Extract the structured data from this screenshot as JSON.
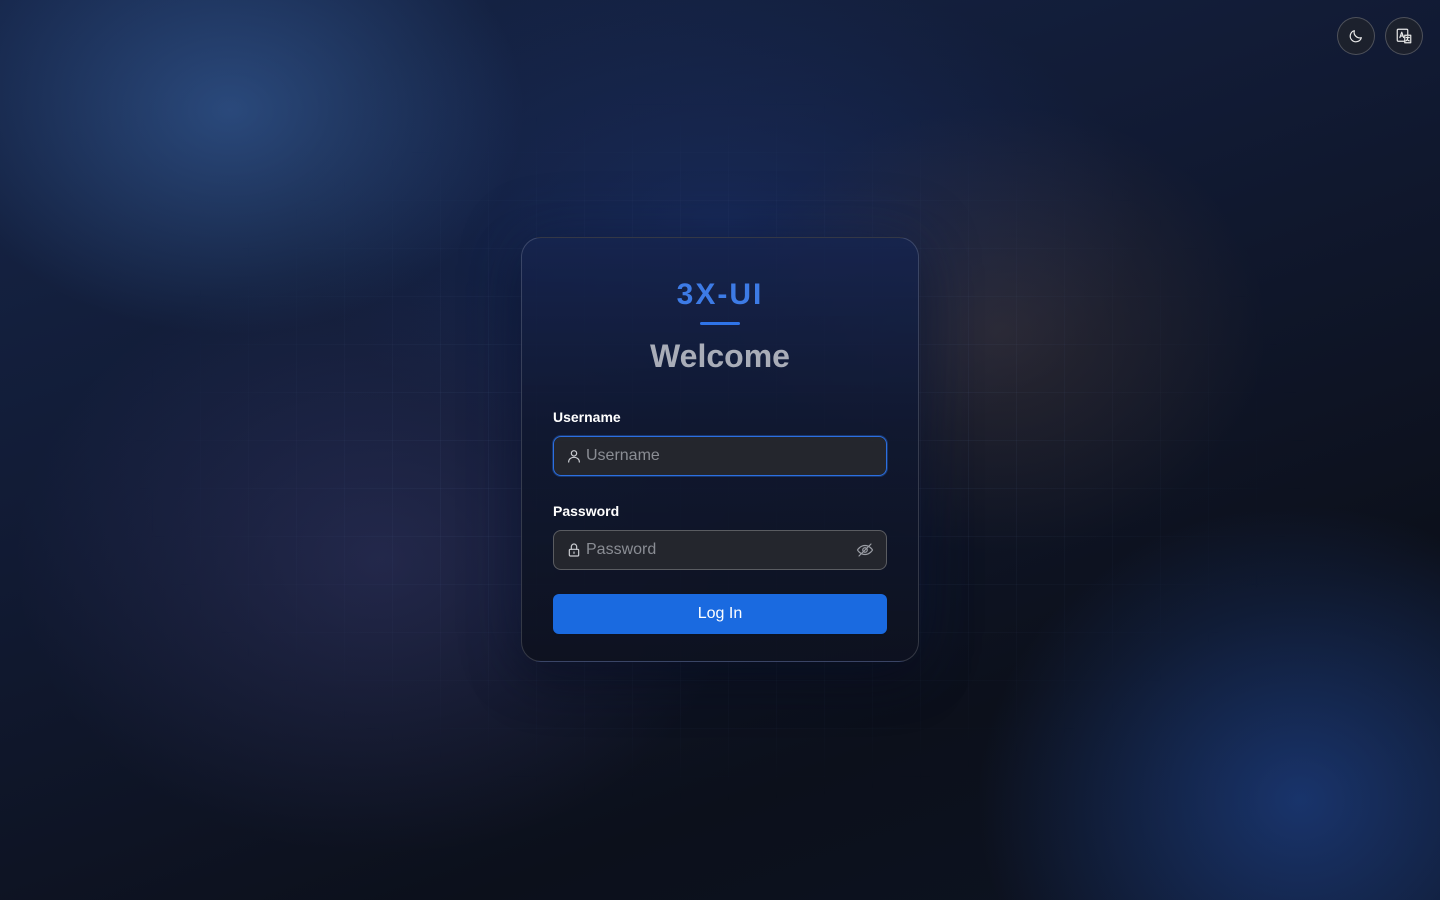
{
  "header": {
    "theme_toggle_icon": "moon-icon",
    "language_icon": "translate-icon"
  },
  "login": {
    "brand": "3X-UI",
    "title": "Welcome",
    "username": {
      "label": "Username",
      "placeholder": "Username",
      "value": "",
      "icon": "user-icon"
    },
    "password": {
      "label": "Password",
      "placeholder": "Password",
      "value": "",
      "icon": "lock-icon",
      "toggle_icon": "eye-off-icon"
    },
    "submit_label": "Log In"
  },
  "colors": {
    "accent": "#1a6ae0",
    "brand": "#3d7be6",
    "focus_border": "#2c6fe0"
  }
}
